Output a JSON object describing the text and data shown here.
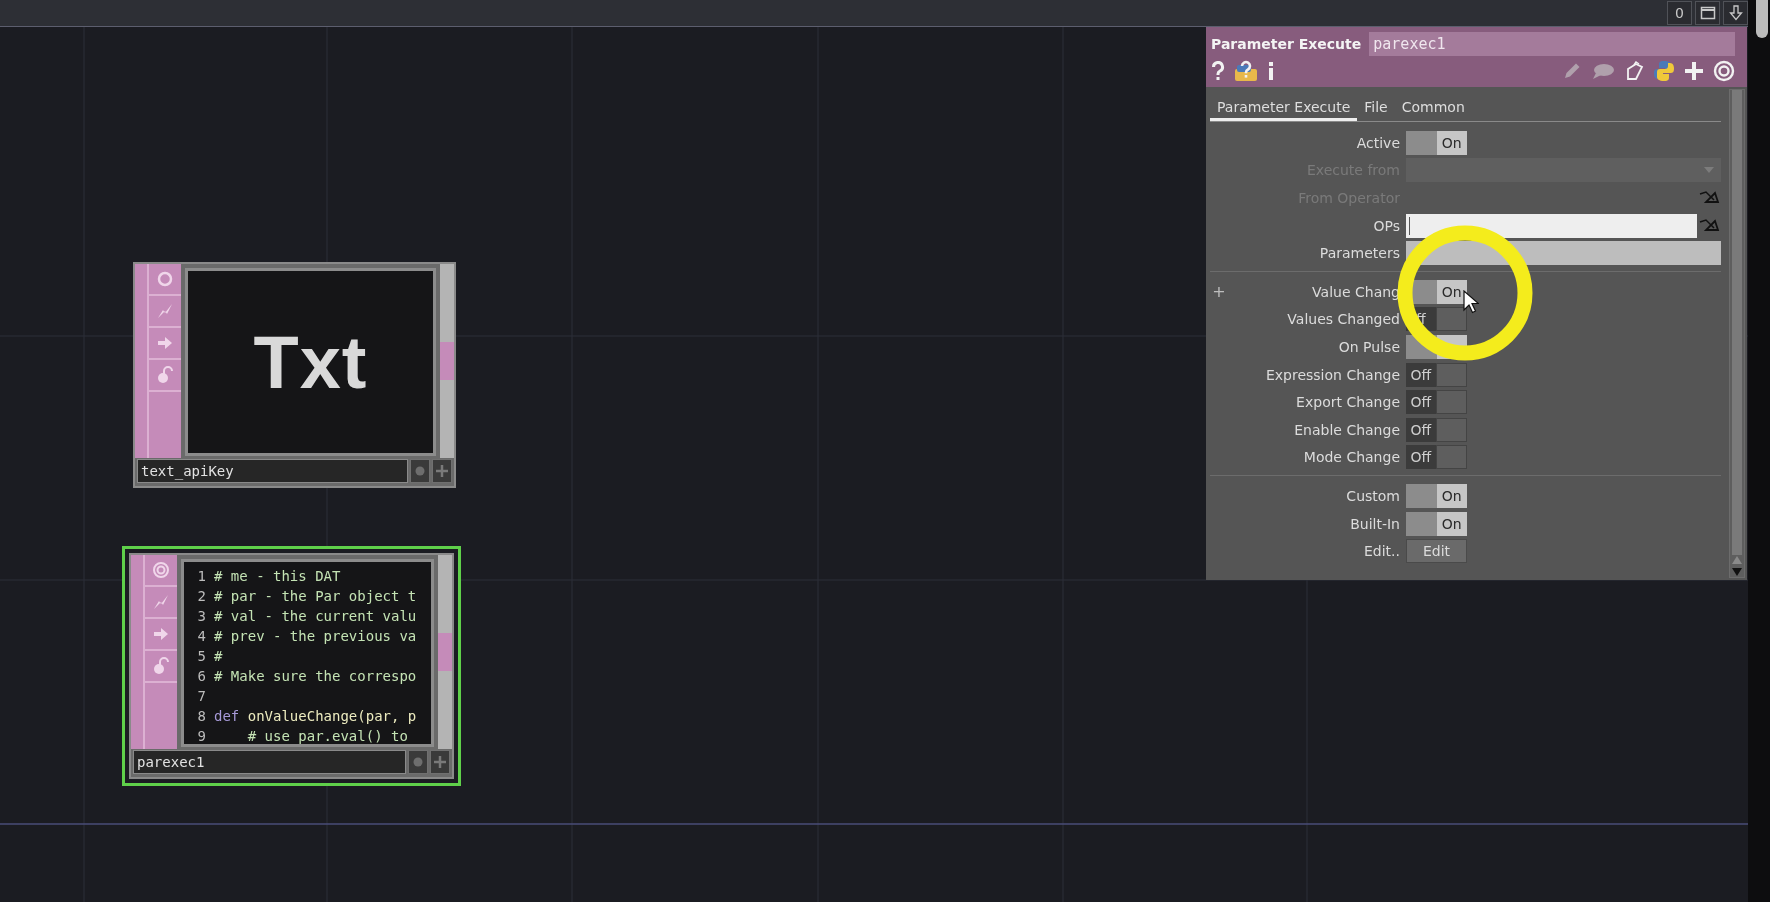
{
  "top_bar": {
    "buttons": [
      {
        "kind": "text",
        "label": "0"
      },
      {
        "kind": "maximize"
      },
      {
        "kind": "download"
      }
    ]
  },
  "nodes": [
    {
      "kind": "text",
      "name": "text_apiKey",
      "preview": "Txt",
      "selected": false
    },
    {
      "kind": "code",
      "name": "parexec1",
      "selected": true,
      "lines": [
        {
          "number": "1",
          "tokens": [
            {
              "kind": "comment",
              "text": "# me - this DAT"
            }
          ]
        },
        {
          "number": "2",
          "tokens": [
            {
              "kind": "comment",
              "text": "# par - the Par object t"
            }
          ]
        },
        {
          "number": "3",
          "tokens": [
            {
              "kind": "comment",
              "text": "# val - the current valu"
            }
          ]
        },
        {
          "number": "4",
          "tokens": [
            {
              "kind": "comment",
              "text": "# prev - the previous va"
            }
          ]
        },
        {
          "number": "5",
          "tokens": [
            {
              "kind": "comment",
              "text": "#"
            }
          ]
        },
        {
          "number": "6",
          "tokens": [
            {
              "kind": "comment",
              "text": "# Make sure the correspo"
            }
          ]
        },
        {
          "number": "7"
        },
        {
          "number": "8",
          "tokens": [
            {
              "kind": "keyword",
              "text": "def "
            },
            {
              "kind": "name",
              "text": "onValueChange(par, p"
            }
          ]
        },
        {
          "number": "9",
          "tokens": [
            {
              "kind": "comment",
              "text": "    # use par.eval() to"
            }
          ]
        }
      ]
    }
  ],
  "panel": {
    "title": "Parameter Execute",
    "name": "parexec1",
    "tabs": [
      {
        "label": "Parameter Execute",
        "selected": true
      },
      {
        "label": "File",
        "selected": false
      },
      {
        "label": "Common",
        "selected": false
      }
    ],
    "rows": [
      {
        "kind": "toggle",
        "label": "Active",
        "disabled": false,
        "on": true,
        "text": "On"
      },
      {
        "kind": "menu",
        "label": "Execute from",
        "disabled": true
      },
      {
        "kind": "op",
        "label": "From Operator",
        "disabled": true
      },
      {
        "kind": "op_field",
        "label": "OPs",
        "disabled": false,
        "focused": true
      },
      {
        "kind": "field",
        "label": "Parameters",
        "disabled": false,
        "focused": false
      },
      {
        "kind": "divider"
      },
      {
        "kind": "toggle",
        "label": "Value Chang",
        "disabled": false,
        "on": true,
        "text": "On",
        "prefix": "+"
      },
      {
        "kind": "toggle",
        "label": "Values Changed",
        "disabled": false,
        "on": false,
        "text": "ff"
      },
      {
        "kind": "toggle",
        "label": "On Pulse",
        "disabled": false,
        "on": true
      },
      {
        "kind": "toggle",
        "label": "Expression Change",
        "disabled": false,
        "on": false,
        "text": "Off"
      },
      {
        "kind": "toggle",
        "label": "Export Change",
        "disabled": false,
        "on": false,
        "text": "Off"
      },
      {
        "kind": "toggle",
        "label": "Enable Change",
        "disabled": false,
        "on": false,
        "text": "Off"
      },
      {
        "kind": "toggle",
        "label": "Mode Change",
        "disabled": false,
        "on": false,
        "text": "Off"
      },
      {
        "kind": "divider"
      },
      {
        "kind": "toggle",
        "label": "Custom",
        "disabled": false,
        "on": true,
        "text": "On"
      },
      {
        "kind": "toggle",
        "label": "Built-In",
        "disabled": false,
        "on": true,
        "text": "On"
      },
      {
        "kind": "button",
        "label": "Edit..",
        "disabled": false,
        "text": "Edit"
      }
    ]
  }
}
